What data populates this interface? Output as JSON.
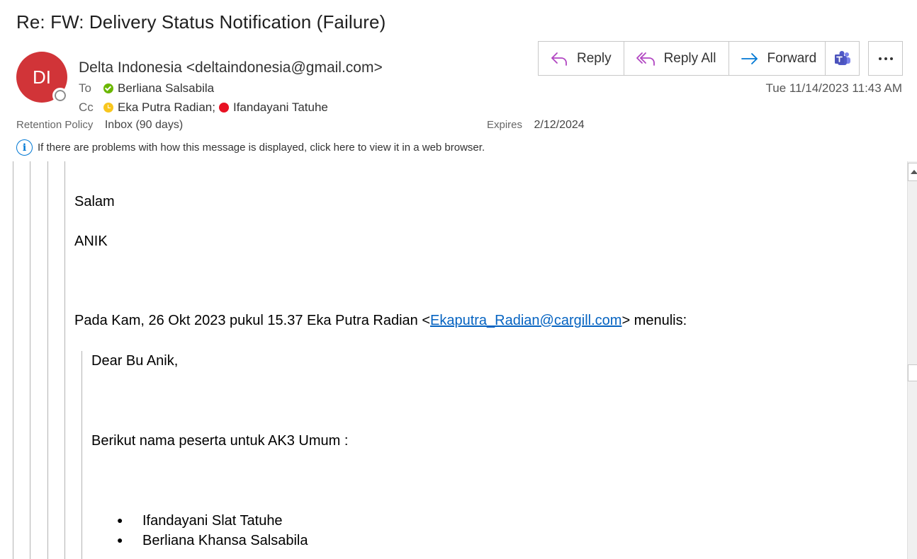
{
  "message": {
    "subject": "Re: FW: Delivery Status Notification (Failure)",
    "avatar_initials": "DI",
    "avatar_color": "#d13438",
    "from": "Delta Indonesia <deltaindonesia@gmail.com>",
    "to_label": "To",
    "to": [
      {
        "name": "Berliana Salsabila",
        "status": "available"
      }
    ],
    "cc_label": "Cc",
    "cc": [
      {
        "name": "Eka Putra Radian;",
        "status": "away"
      },
      {
        "name": "Ifandayani Tatuhe",
        "status": "busy"
      }
    ],
    "date": "Tue 11/14/2023 11:43 AM",
    "retention_label": "Retention Policy",
    "retention_value": "Inbox (90 days)",
    "expires_label": "Expires",
    "expires_value": "2/12/2024",
    "info_text": "If there are problems with how this message is displayed, click here to view it in a web browser."
  },
  "toolbar": {
    "reply": "Reply",
    "reply_all": "Reply All",
    "forward": "Forward",
    "teams_icon": "teams-icon",
    "more_icon": "more-icon"
  },
  "body": {
    "salam": "Salam",
    "anik": "ANIK",
    "quote_intro_pre": "Pada Kam, 26 Okt 2023 pukul 15.37 Eka Putra Radian <",
    "quote_intro_link": "Ekaputra_Radian@cargill.com",
    "quote_intro_post": "> menulis:",
    "greeting": "Dear Bu Anik,",
    "list_intro": "Berikut nama peserta untuk AK3 Umum :",
    "participants": [
      "Ifandayani Slat Tatuhe",
      "Berliana Khansa Salsabila"
    ]
  },
  "colors": {
    "accent": "#0078d4",
    "purple_icon": "#b146c2",
    "link": "#0563c1",
    "available": "#6bb700",
    "away": "#f8c61e",
    "busy": "#e81123"
  }
}
